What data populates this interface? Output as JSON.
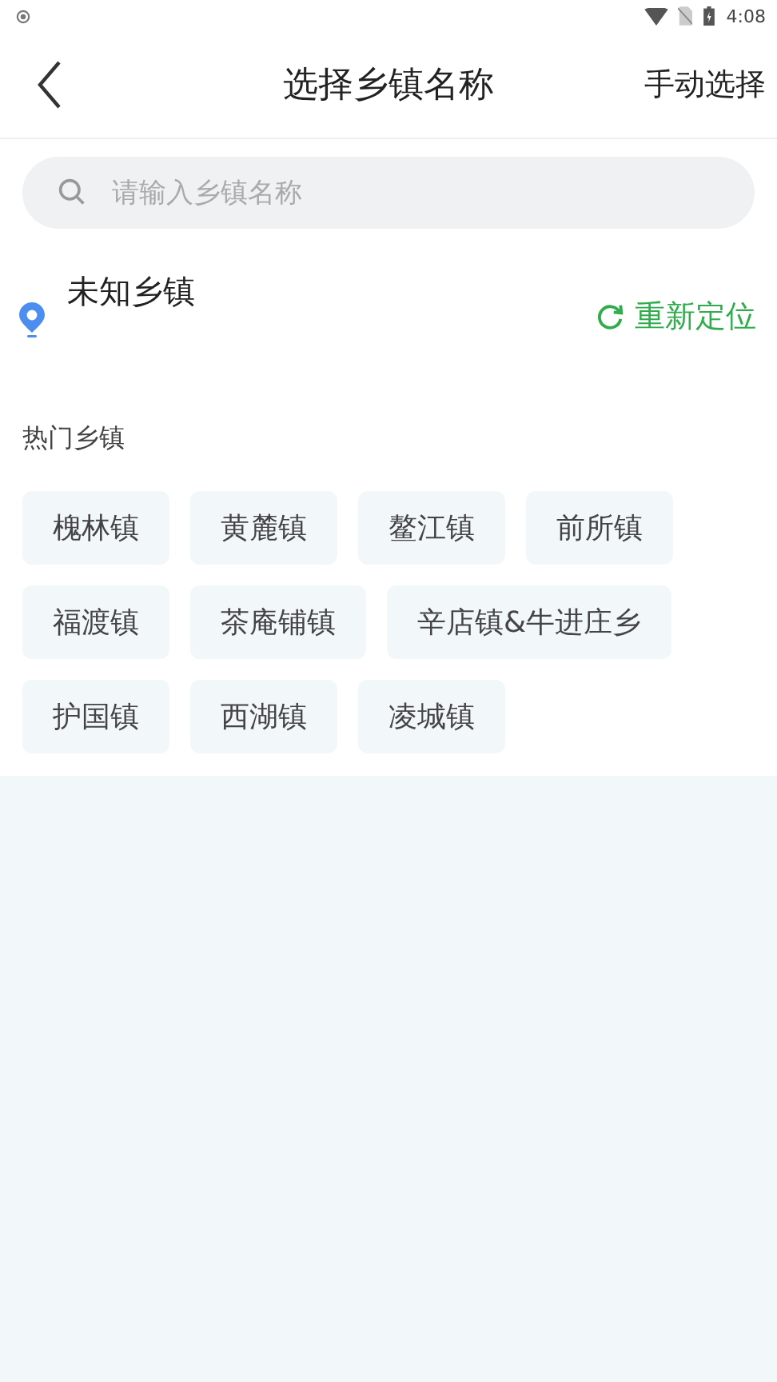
{
  "status_bar": {
    "time": "4:08"
  },
  "header": {
    "title": "选择乡镇名称",
    "action": "手动选择"
  },
  "search": {
    "placeholder": "请输入乡镇名称"
  },
  "location": {
    "name": "未知乡镇",
    "relocate": "重新定位"
  },
  "hot": {
    "title": "热门乡镇",
    "items": [
      "槐林镇",
      "黄麓镇",
      "鳌江镇",
      "前所镇",
      "福渡镇",
      "茶庵铺镇",
      "辛店镇&牛进庄乡",
      "护国镇",
      "西湖镇",
      "凌城镇"
    ]
  }
}
